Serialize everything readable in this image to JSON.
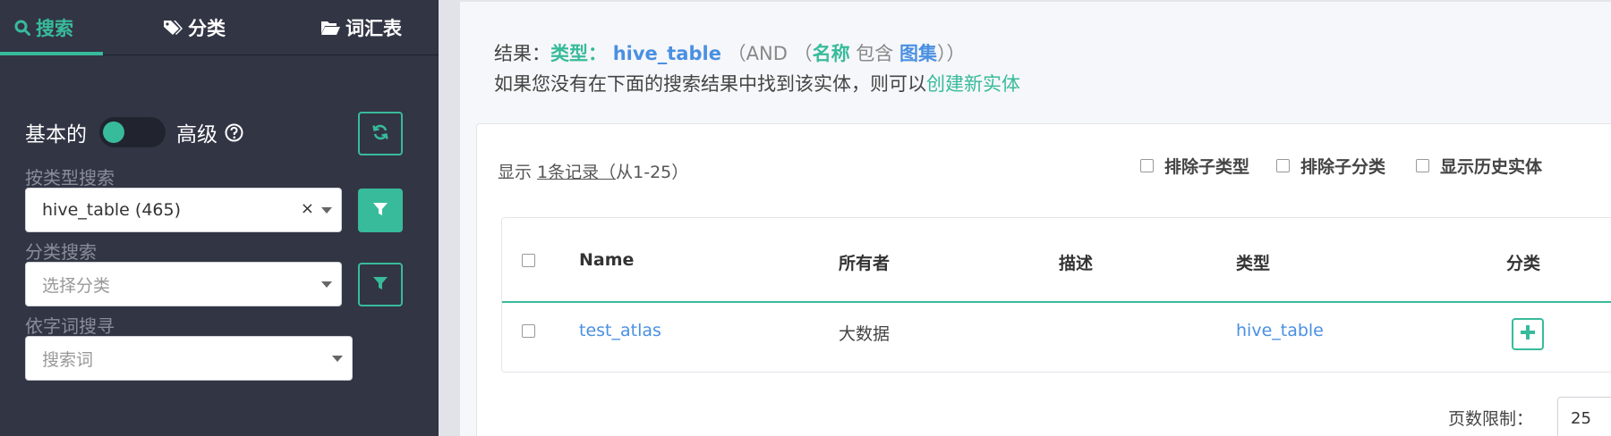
{
  "sidebar": {
    "tabs": [
      {
        "label": "搜索",
        "icon": "search-icon"
      },
      {
        "label": "分类",
        "icon": "tags-icon"
      },
      {
        "label": "词汇表",
        "icon": "folder-open-icon"
      }
    ],
    "mode": {
      "basic": "基本的",
      "advanced": "高级"
    },
    "type_search": {
      "label": "按类型搜索",
      "value": "hive_table (465)",
      "clear": "×"
    },
    "classification_search": {
      "label": "分类搜索",
      "placeholder": "选择分类"
    },
    "term_search": {
      "label": "依字词搜寻",
      "placeholder": "搜索词"
    }
  },
  "main": {
    "result": {
      "prefix": "结果：",
      "type_label": "类型：",
      "type_value": "hive_table",
      "op": "（AND",
      "paren_open": "（",
      "name_label": "名称",
      "contains": "包含",
      "contains_value": "图集",
      "paren_close": "））"
    },
    "hint": {
      "text": "如果您没有在下面的搜索结果中找到该实体，则可以",
      "link": "创建新实体"
    },
    "showing": {
      "prefix": "显示 ",
      "count": "1条记录（",
      "range": "从1-25）"
    },
    "options": [
      "排除子类型",
      "排除子分类",
      "显示历史实体"
    ],
    "table": {
      "headers": [
        "Name",
        "所有者",
        "描述",
        "类型",
        "分类"
      ],
      "rows": [
        {
          "name": "test_atlas",
          "owner": "大数据",
          "description": "",
          "type": "hive_table"
        }
      ]
    },
    "page_limit": {
      "label": "页数限制：",
      "value": "25"
    }
  },
  "colors": {
    "accent": "#38bb9b",
    "link": "#4a90e2",
    "sidebar_bg": "#323544"
  }
}
